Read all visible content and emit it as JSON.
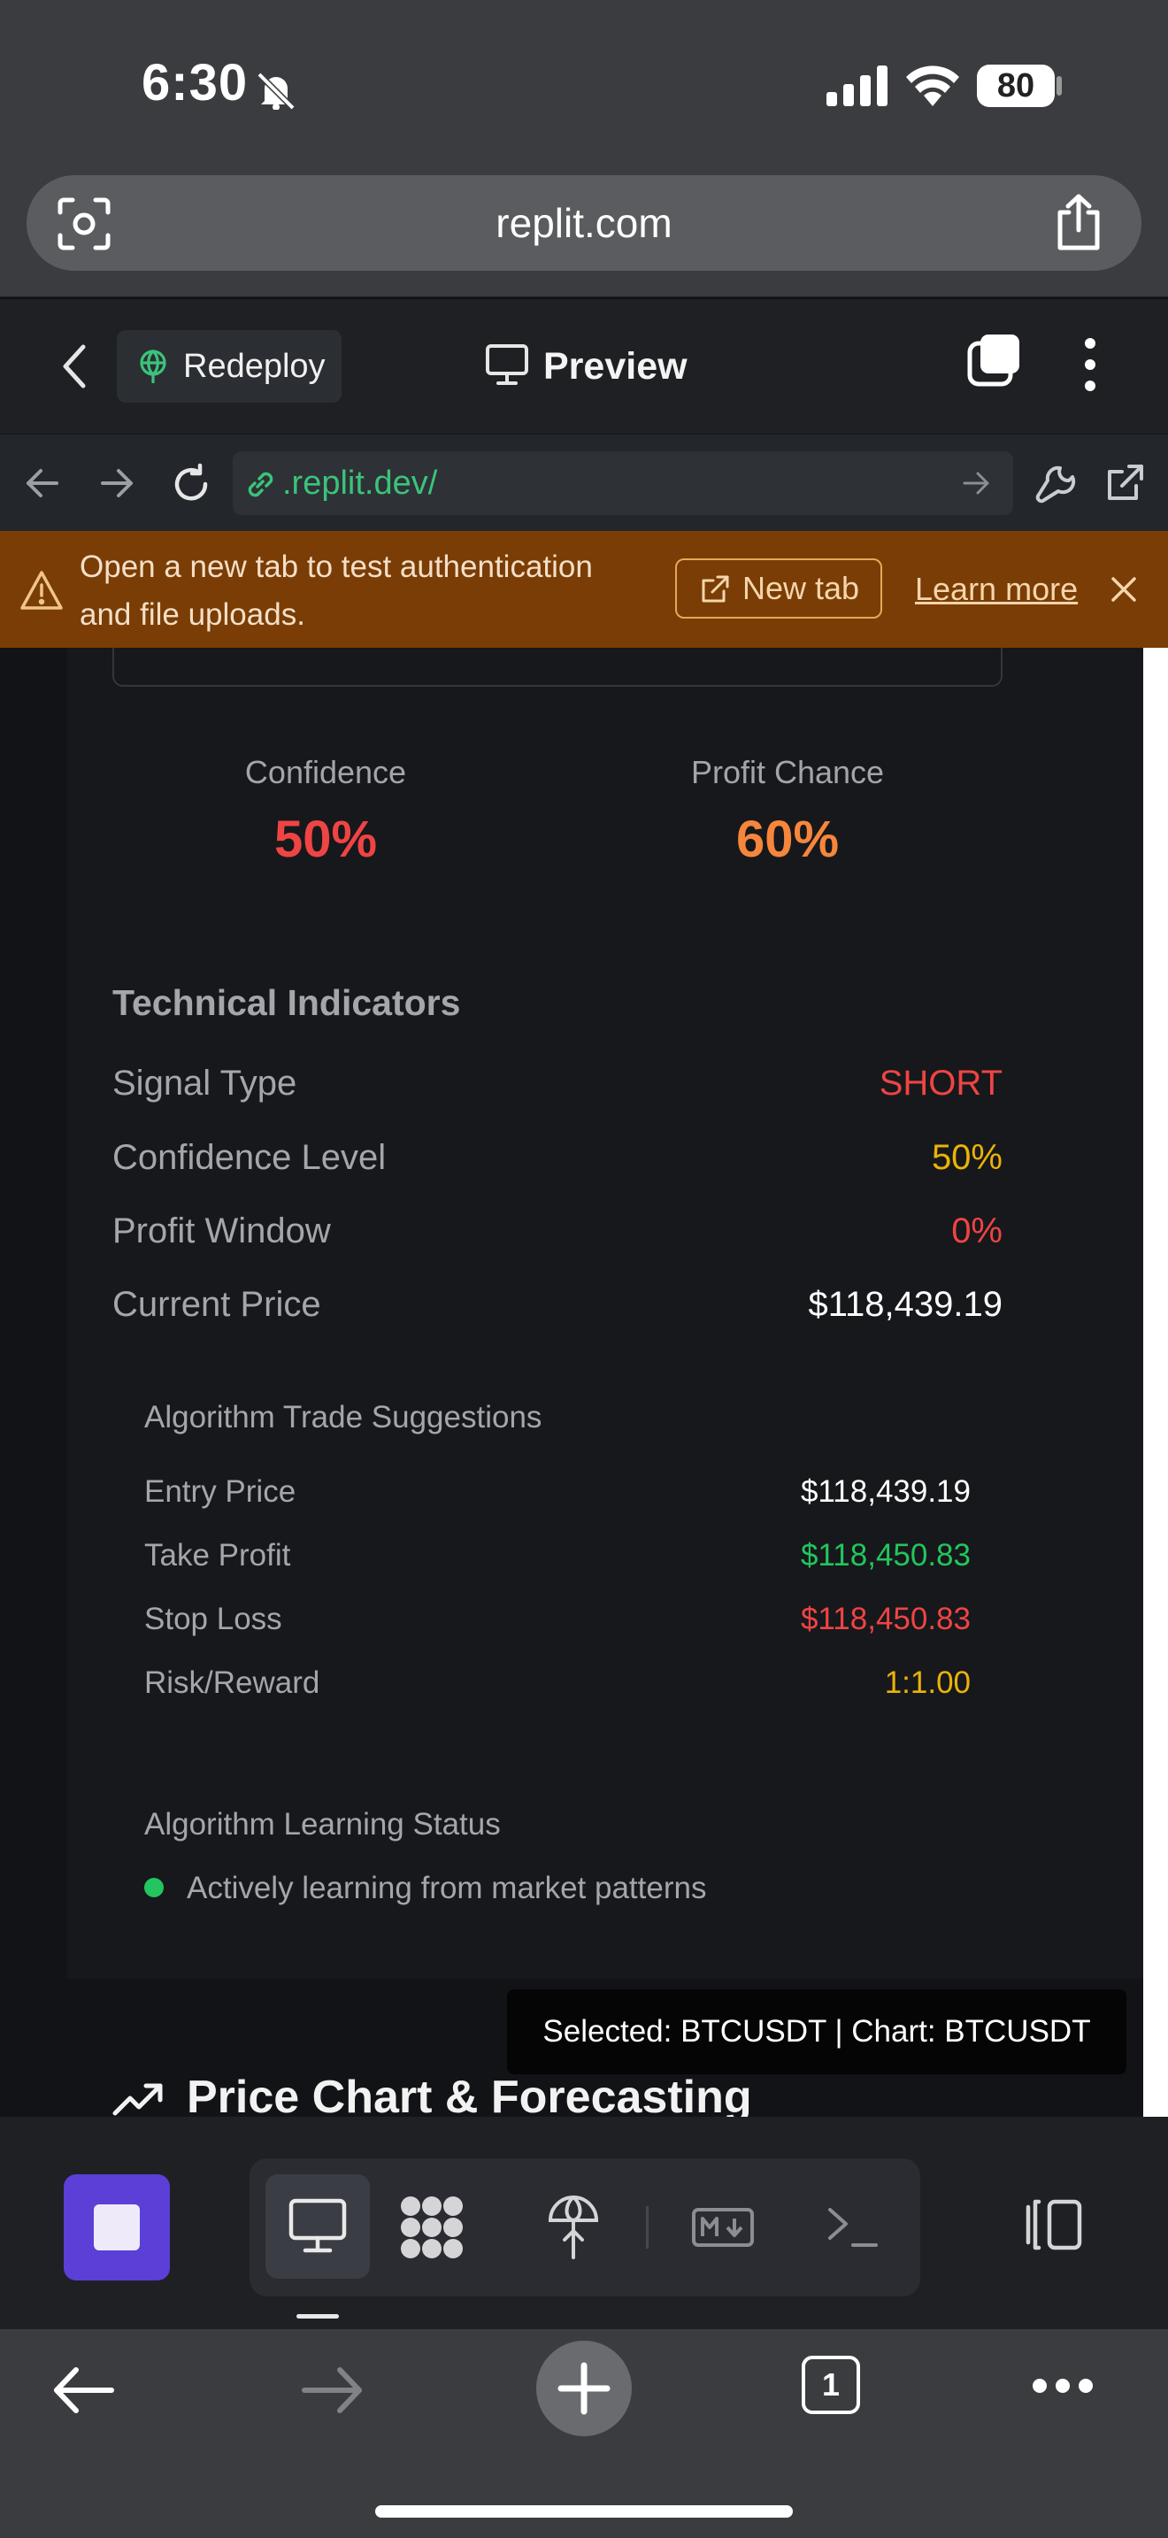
{
  "status_bar": {
    "time": "6:30",
    "battery": "80"
  },
  "browser": {
    "url": "replit.com"
  },
  "replit_header": {
    "redeploy_label": "Redeploy",
    "preview_label": "Preview"
  },
  "preview_nav": {
    "address": ".replit.dev/"
  },
  "banner": {
    "message": "Open a new tab to test authentication and file uploads.",
    "new_tab_label": "New tab",
    "learn_more_label": "Learn more"
  },
  "stats": [
    {
      "label": "Confidence",
      "value": "50%",
      "color": "#ef4444"
    },
    {
      "label": "Profit Chance",
      "value": "60%",
      "color": "#f5863b"
    }
  ],
  "technical_indicators": {
    "title": "Technical Indicators",
    "rows": [
      {
        "label": "Signal Type",
        "value": "SHORT",
        "color": "#ef4444"
      },
      {
        "label": "Confidence Level",
        "value": "50%",
        "color": "#eab308"
      },
      {
        "label": "Profit Window",
        "value": "0%",
        "color": "#ef4444"
      },
      {
        "label": "Current Price",
        "value": "$118,439.19",
        "color": "#ffffff"
      }
    ]
  },
  "trade_suggestions": {
    "title": "Algorithm Trade Suggestions",
    "rows": [
      {
        "label": "Entry Price",
        "value": "$118,439.19",
        "color": "#ffffff"
      },
      {
        "label": "Take Profit",
        "value": "$118,450.83",
        "color": "#22c55e"
      },
      {
        "label": "Stop Loss",
        "value": "$118,450.83",
        "color": "#ef4444"
      },
      {
        "label": "Risk/Reward",
        "value": "1:1.00",
        "color": "#eab308"
      }
    ]
  },
  "learning_status": {
    "title": "Algorithm Learning Status",
    "text": "Actively learning from market patterns"
  },
  "toast": {
    "text": "Selected: BTCUSDT | Chart: BTCUSDT"
  },
  "section_heading": {
    "text": "Price Chart & Forecasting"
  },
  "safari_bottom": {
    "tab_count": "1"
  }
}
